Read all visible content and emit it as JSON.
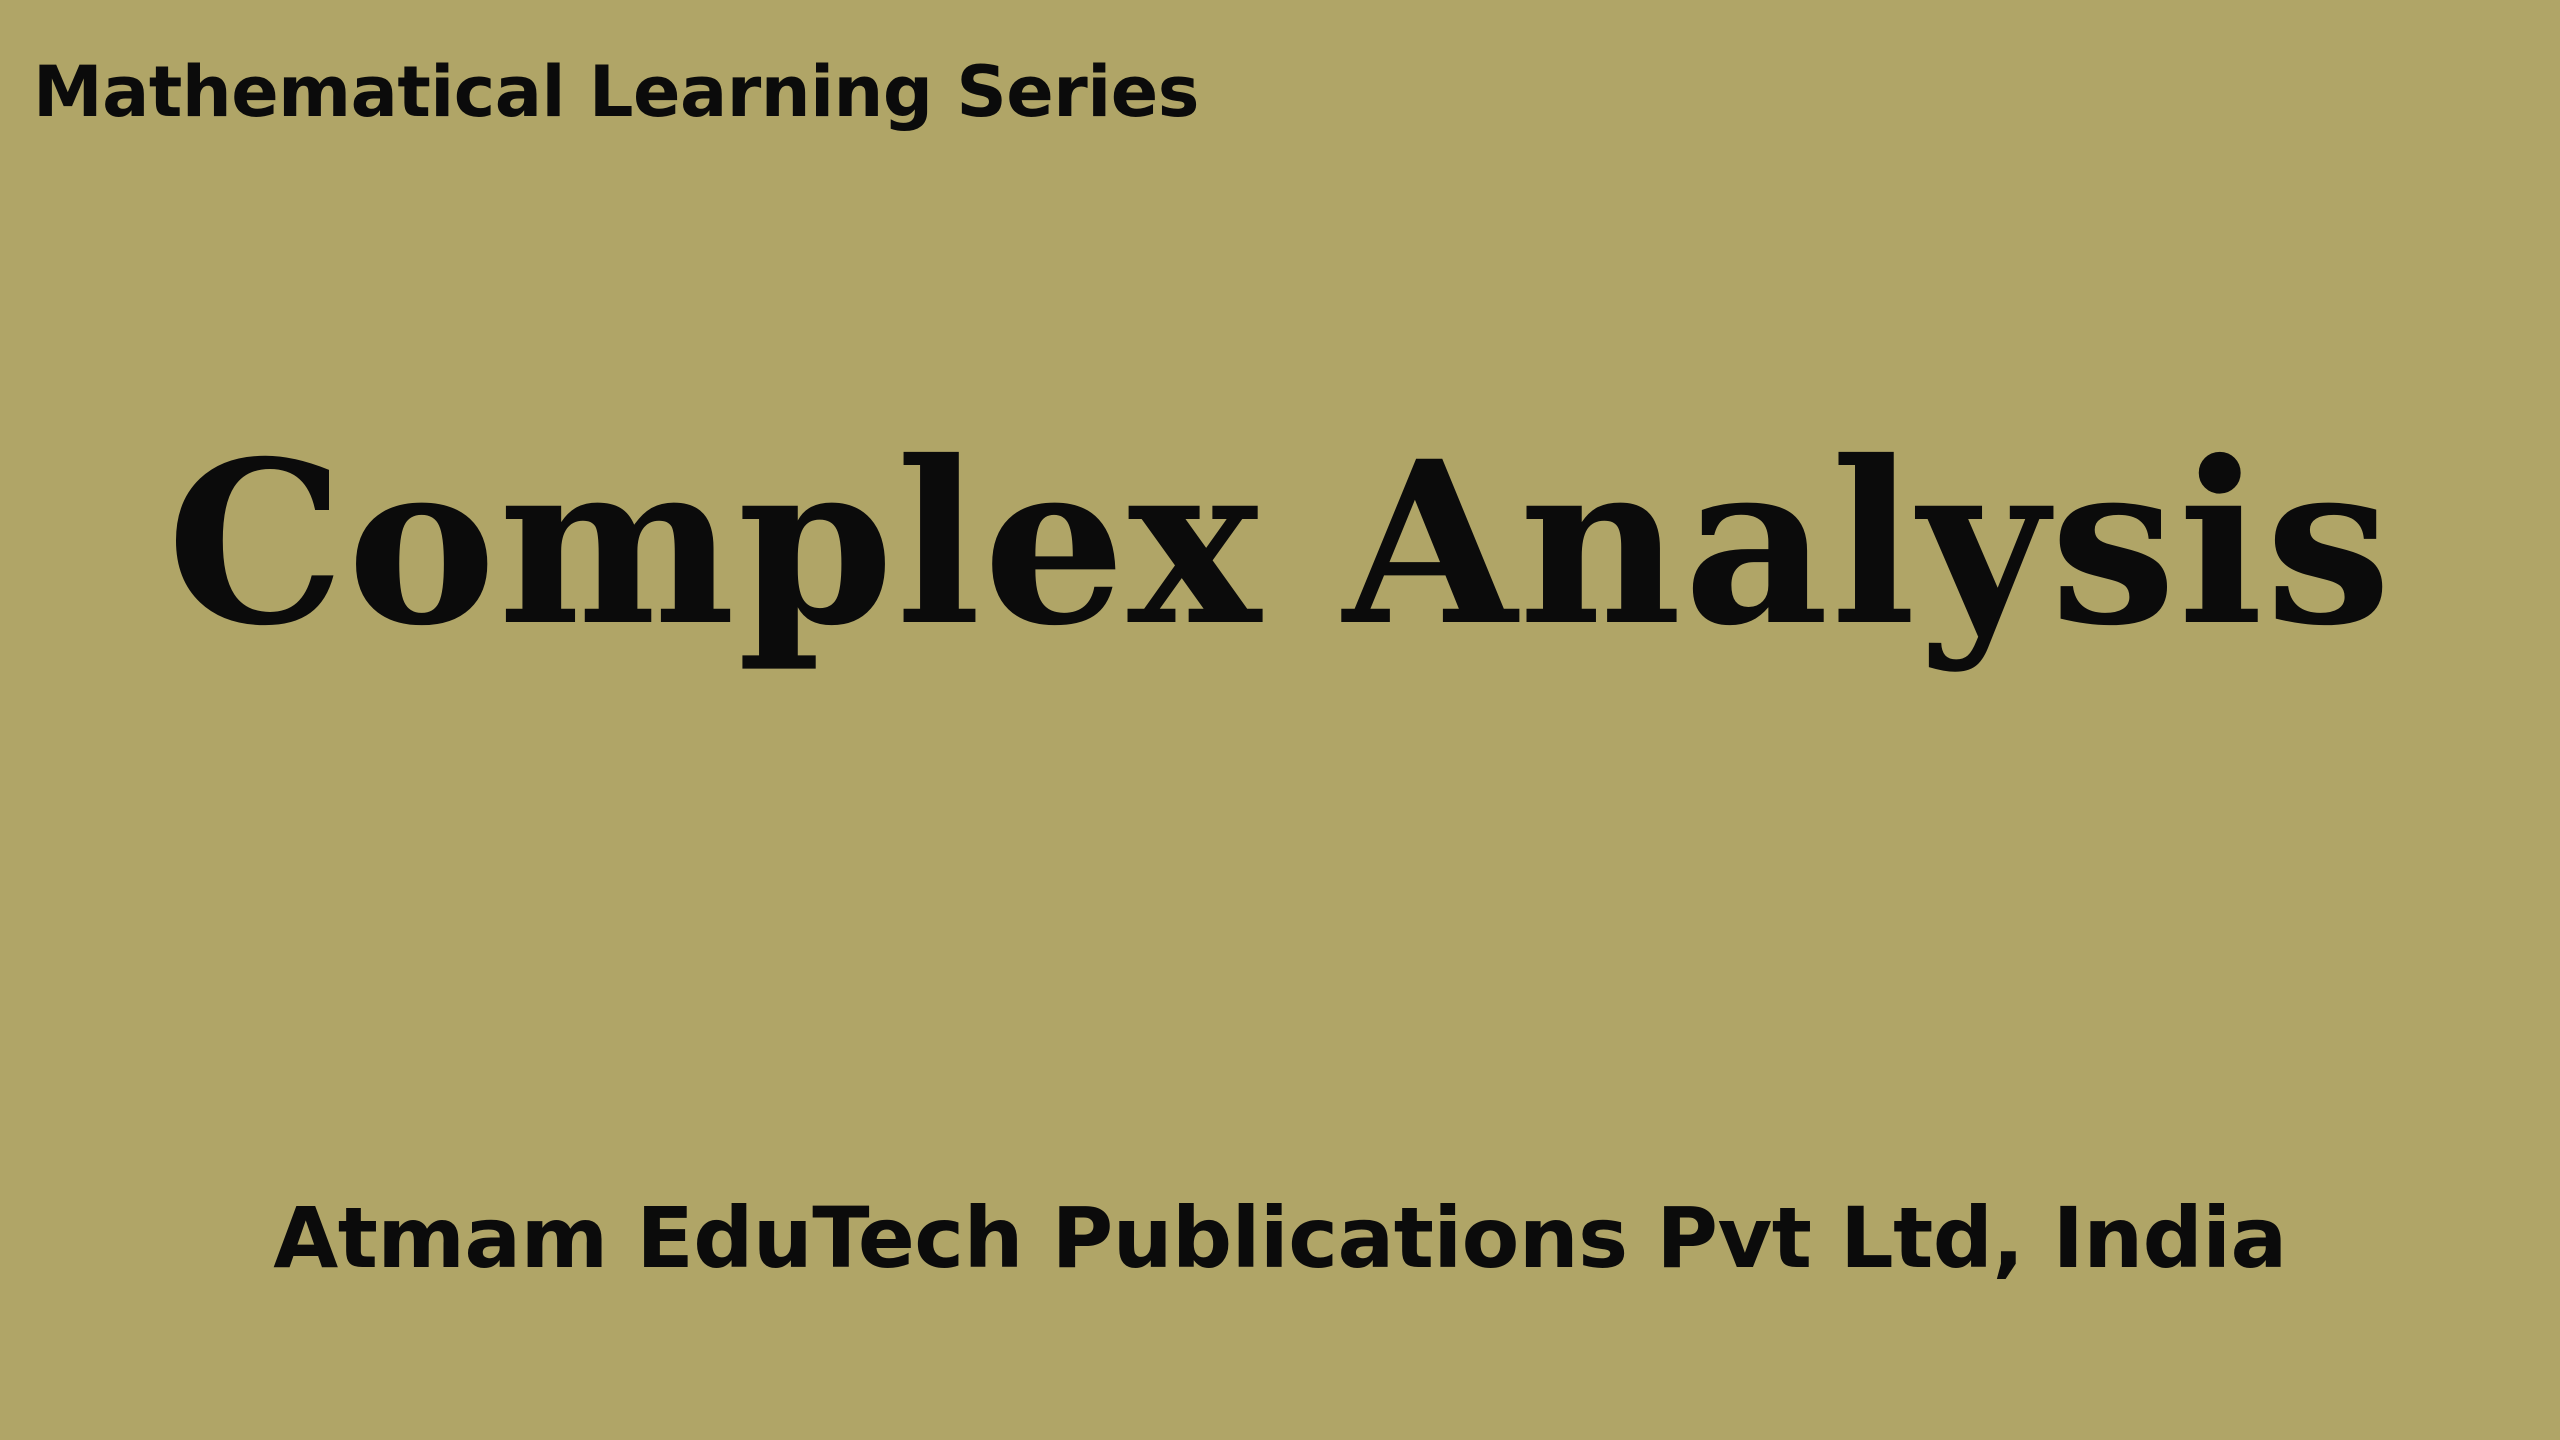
{
  "colors": {
    "background": "#b0a567",
    "text": "#0b0b0b"
  },
  "cover": {
    "series_label": "Mathematical Learning Series",
    "title": "Complex Analysis",
    "publisher": "Atmam EduTech Publications Pvt Ltd, India"
  }
}
